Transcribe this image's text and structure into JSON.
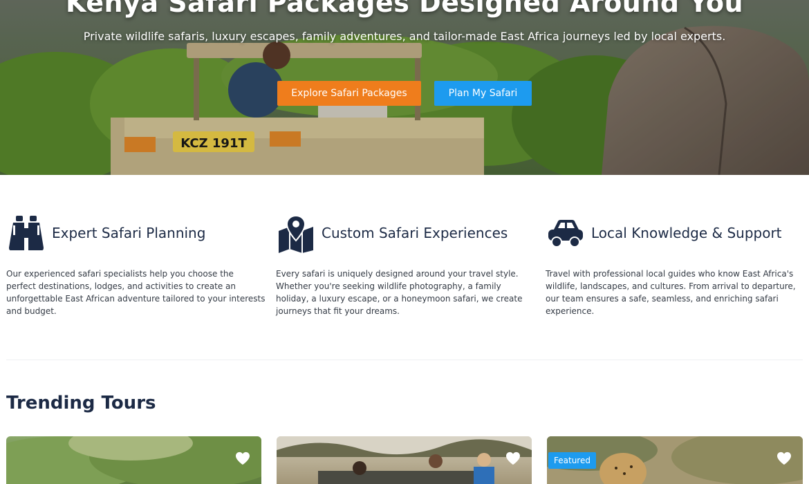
{
  "hero": {
    "title": "Kenya Safari Packages Designed Around You",
    "subtitle": "Private wildlife safaris, luxury escapes, family adventures, and tailor-made East Africa journeys led by local experts.",
    "primary_button": "Explore Safari Packages",
    "secondary_button": "Plan My Safari",
    "vehicle_plate": "KCZ 191T"
  },
  "features": [
    {
      "icon": "binoculars-icon",
      "title": "Expert Safari Planning",
      "description": "Our experienced safari specialists help you choose the perfect destinations, lodges, and activities to create an unforgettable East African adventure tailored to your interests and budget."
    },
    {
      "icon": "map-pin-icon",
      "title": "Custom Safari Experiences",
      "description": "Every safari is uniquely designed around your travel style. Whether you're seeking wildlife photography, a family holiday, a luxury escape, or a honeymoon safari, we create journeys that fit your dreams."
    },
    {
      "icon": "car-icon",
      "title": "Local Knowledge & Support",
      "description": "Travel with professional local guides who know East Africa's wildlife, landscapes, and cultures. From arrival to departure, our team ensures a safe, seamless, and enriching safari experience."
    }
  ],
  "trending": {
    "title": "Trending Tours",
    "cards": [
      {
        "badge": ""
      },
      {
        "badge": ""
      },
      {
        "badge": "Featured"
      }
    ]
  },
  "colors": {
    "primary_orange": "#ef7d1c",
    "primary_blue": "#1d9bef",
    "navy": "#1c2a45"
  }
}
